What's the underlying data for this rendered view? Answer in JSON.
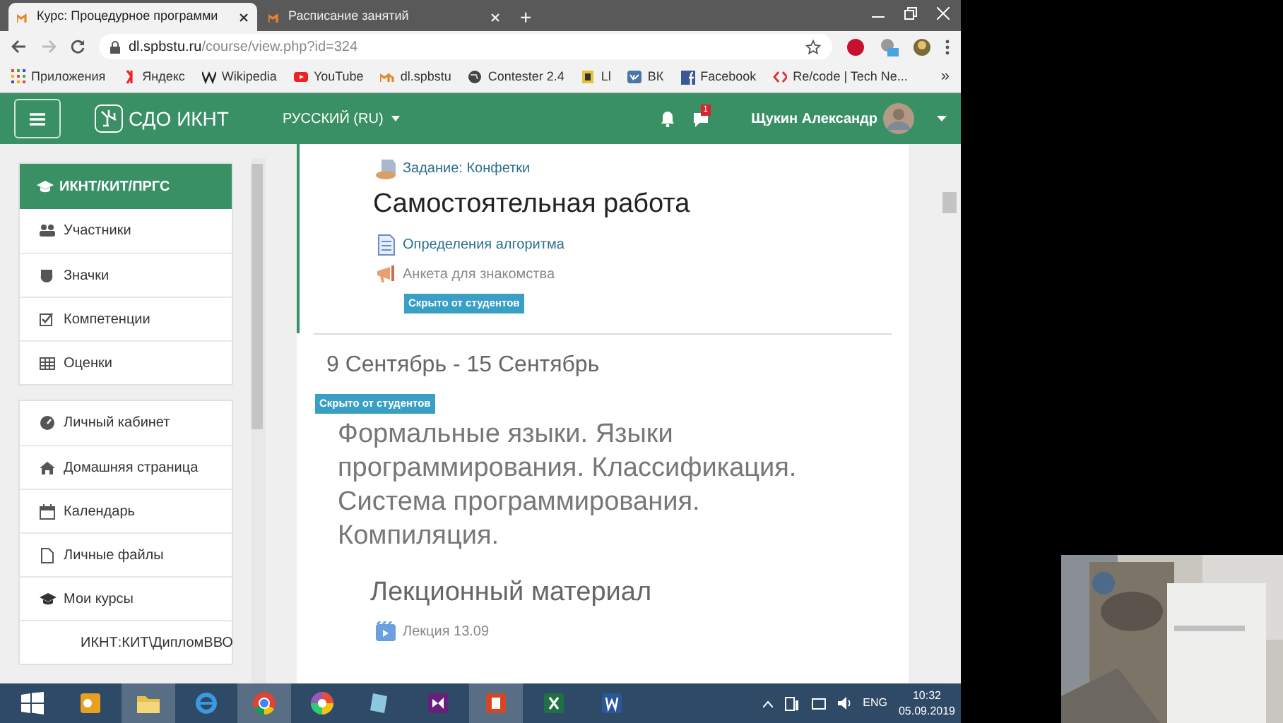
{
  "browser": {
    "tabs": [
      {
        "title": "Курс: Процедурное программи",
        "selected": true
      },
      {
        "title": "Расписание занятий",
        "selected": false
      }
    ],
    "new_tab": "+",
    "address": {
      "host": "dl.spbstu.ru",
      "path": "/course/view.php?id=324"
    },
    "bookmarks": [
      {
        "kind": "apps",
        "label": "Приложения"
      },
      {
        "kind": "yandex",
        "label": "Яндекс"
      },
      {
        "kind": "wiki",
        "label": "Wikipedia"
      },
      {
        "kind": "youtube",
        "label": "YouTube"
      },
      {
        "kind": "moodle",
        "label": "dl.spbstu"
      },
      {
        "kind": "globe",
        "label": "Contester 2.4"
      },
      {
        "kind": "doc",
        "label": "Ll"
      },
      {
        "kind": "vk",
        "label": "ВК"
      },
      {
        "kind": "facebook",
        "label": "Facebook"
      },
      {
        "kind": "code",
        "label": "Re/code | Tech Ne..."
      }
    ],
    "bookmarks_more": "»"
  },
  "navbar": {
    "brand": "СДО ИКНТ",
    "language": "РУССКИЙ (RU)",
    "messages_badge": "1",
    "user": "Щукин Александр"
  },
  "sidebar": {
    "course_block": {
      "title": "ИКНТ/КИТ/ПРГС",
      "items": [
        {
          "kind": "users",
          "label": "Участники"
        },
        {
          "kind": "shield",
          "label": "Значки"
        },
        {
          "kind": "check",
          "label": "Компетенции"
        },
        {
          "kind": "table",
          "label": "Оценки"
        }
      ]
    },
    "nav_block": {
      "items": [
        {
          "kind": "dashboard",
          "label": "Личный кабинет"
        },
        {
          "kind": "home",
          "label": "Домашняя страница"
        },
        {
          "kind": "calendar",
          "label": "Календарь"
        },
        {
          "kind": "file",
          "label": "Личные файлы"
        },
        {
          "kind": "cap",
          "label": "Мои курсы",
          "children": [
            {
              "kind": "cap",
              "label": "ИКНТ:КИТ\\ДипломВВО"
            }
          ]
        }
      ]
    }
  },
  "sections": [
    {
      "current": true,
      "blocks": [
        {
          "kind": "assignment",
          "label": "Задание: Конфетки",
          "dimmed": false
        },
        {
          "kind": "subheading",
          "text": "Самостоятельная работа"
        },
        {
          "kind": "page",
          "label": "Определения алгоритма",
          "dimmed": false
        },
        {
          "kind": "feedback",
          "label": "Анкета для знакомства",
          "dimmed": true,
          "badge": "Скрыто от студентов"
        }
      ]
    },
    {
      "current": false,
      "title": "9 Сентябрь - 15 Сентябрь",
      "badge": "Скрыто от студентов",
      "blocks": [
        {
          "kind": "summary",
          "text": "Формальные языки. Языки программирования. Классификация. Система программирования. Компиляция."
        },
        {
          "kind": "subheading",
          "text": "Лекционный материал"
        },
        {
          "kind": "video",
          "label": "Лекция 13.09",
          "dimmed": true
        }
      ]
    }
  ],
  "taskbar": {
    "apps": [
      {
        "kind": "outlook",
        "open": false
      },
      {
        "kind": "explorer",
        "open": true
      },
      {
        "kind": "ie",
        "open": false
      },
      {
        "kind": "chrome",
        "open": true
      },
      {
        "kind": "picasa",
        "open": false
      },
      {
        "kind": "notes",
        "open": false
      },
      {
        "kind": "vs",
        "open": false
      },
      {
        "kind": "powerpoint",
        "open": true
      },
      {
        "kind": "excel",
        "open": false
      },
      {
        "kind": "word",
        "open": false
      }
    ],
    "language": "ENG",
    "time": "10:32",
    "date": "05.09.2019"
  }
}
